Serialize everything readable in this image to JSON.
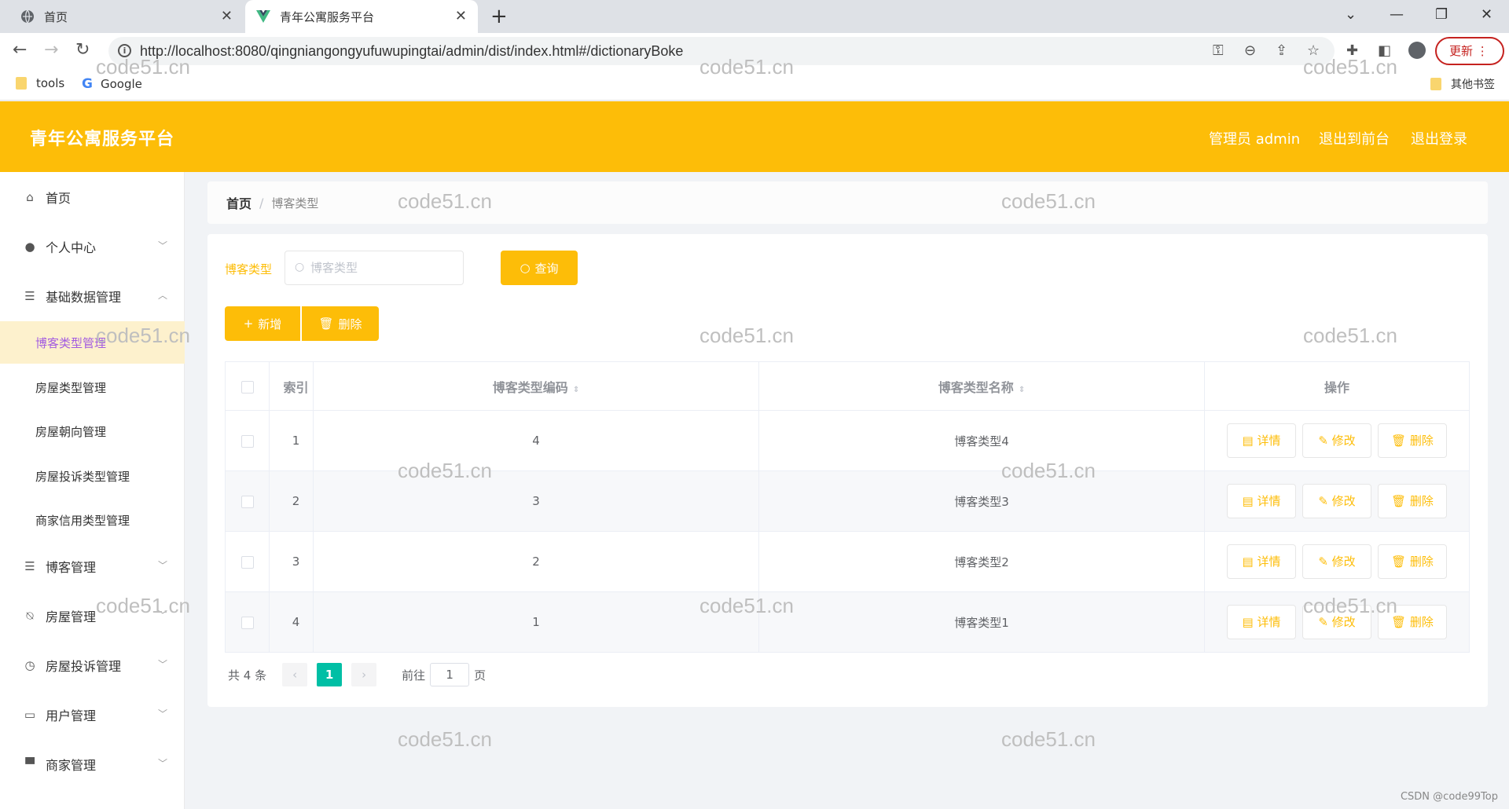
{
  "browser": {
    "tabs": [
      {
        "label": "首页",
        "icon": "globe-icon"
      },
      {
        "label": "青年公寓服务平台",
        "icon": "vue-logo-icon"
      }
    ],
    "url": "http://localhost:8080/qingniangongyufuwupingtai/admin/dist/index.html#/dictionaryBoke",
    "update_label": "更新",
    "bookmarks": [
      "tools",
      "Google"
    ],
    "other_bookmarks": "其他书签"
  },
  "header": {
    "title": "青年公寓服务平台",
    "user": "管理员 admin",
    "to_front": "退出到前台",
    "logout": "退出登录",
    "accent_color": "#fdbd08"
  },
  "sidebar": {
    "items": [
      {
        "label": "首页",
        "icon": "home-icon"
      },
      {
        "label": "个人中心",
        "icon": "user-icon"
      },
      {
        "label": "基础数据管理",
        "icon": "list-icon"
      },
      {
        "label": "博客管理",
        "icon": "list-icon"
      },
      {
        "label": "房屋管理",
        "icon": "bell-off-icon"
      },
      {
        "label": "房屋投诉管理",
        "icon": "clock-icon"
      },
      {
        "label": "用户管理",
        "icon": "chat-icon"
      },
      {
        "label": "商家管理",
        "icon": "stamp-icon"
      }
    ],
    "sub_items": [
      "博客类型管理",
      "房屋类型管理",
      "房屋朝向管理",
      "房屋投诉类型管理",
      "商家信用类型管理"
    ]
  },
  "breadcrumb": {
    "home": "首页",
    "current": "博客类型"
  },
  "search": {
    "label": "博客类型",
    "placeholder": "博客类型",
    "query_label": "查询"
  },
  "actions": {
    "add_label": "新增",
    "delete_label": "删除"
  },
  "table": {
    "headers": {
      "index": "索引",
      "code": "博客类型编码",
      "name": "博客类型名称",
      "ops": "操作"
    },
    "rows": [
      {
        "index": "1",
        "code": "4",
        "name": "博客类型4"
      },
      {
        "index": "2",
        "code": "3",
        "name": "博客类型3"
      },
      {
        "index": "3",
        "code": "2",
        "name": "博客类型2"
      },
      {
        "index": "4",
        "code": "1",
        "name": "博客类型1"
      }
    ],
    "row_ops": {
      "detail": "详情",
      "edit": "修改",
      "delete": "删除"
    }
  },
  "pagination": {
    "total": "共 4 条",
    "current": "1",
    "goto_prefix": "前往",
    "goto_value": "1",
    "goto_suffix": "页"
  },
  "watermark": "code51.cn",
  "credit": "CSDN @code99Top"
}
